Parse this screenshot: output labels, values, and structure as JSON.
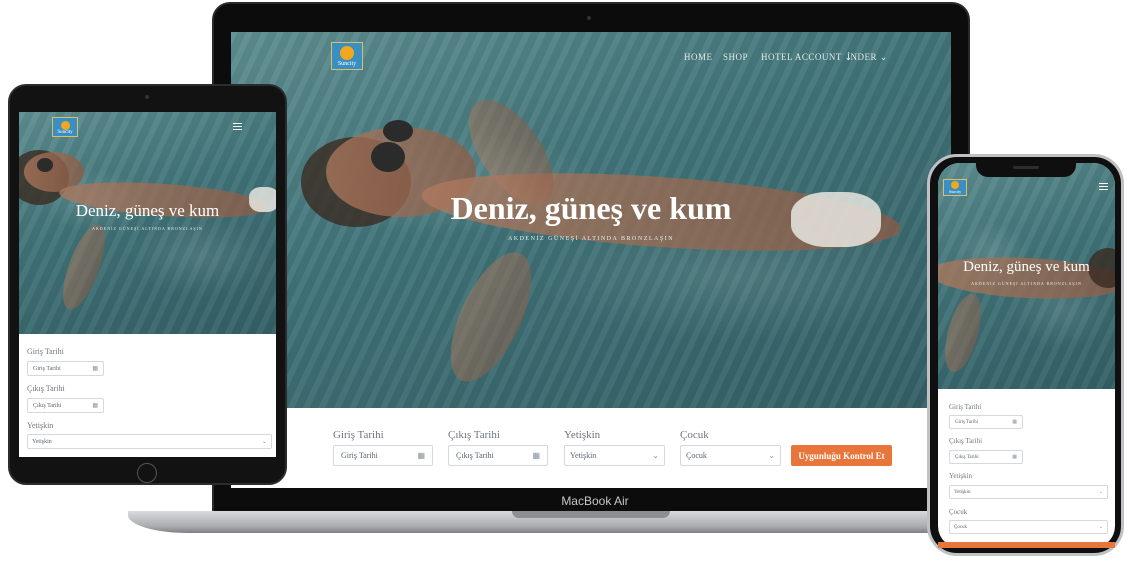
{
  "site": {
    "logo_text": "Suncity",
    "hero_title": "Deniz, güneş ve kum",
    "hero_subtitle": "AKDENİZ GÜNEŞİ ALTINDA BRONZLAŞIN"
  },
  "nav": {
    "items": [
      "HOME",
      "SHOP",
      "HOTEL ACCOUNT ⌄",
      "İNDER ⌄"
    ]
  },
  "booking": {
    "checkin_label": "Giriş Tarihi",
    "checkin_placeholder": "Giriş Tarihi",
    "checkout_label": "Çıkış Tarihi",
    "checkout_placeholder": "Çıkış Tarihi",
    "adults_label": "Yetişkin",
    "adults_value": "Yetişkin",
    "children_label": "Çocuk",
    "children_value": "Çocuk",
    "check_button": "Uygunluğu Kontrol Et"
  },
  "device": {
    "laptop_brand": "MacBook Air"
  },
  "icons": {
    "calendar": "calendar-icon",
    "chevron": "chevron-down-icon",
    "menu": "hamburger-menu-icon"
  },
  "colors": {
    "accent": "#e8763a",
    "pool": "#3f7277",
    "logo_bg": "#3a8fc0",
    "sun": "#f2a71e"
  }
}
